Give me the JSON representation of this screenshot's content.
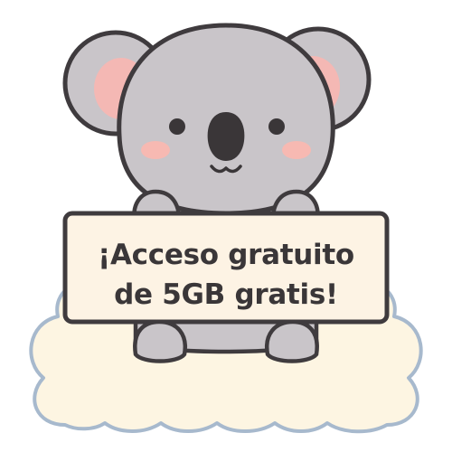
{
  "sticker": {
    "subject": "koala",
    "sign": {
      "line1": "¡Acceso gratuito",
      "line2": "de 5GB gratis!"
    }
  },
  "colors": {
    "fur": "#c9c5c9",
    "fur_light": "#d8d4d8",
    "outline": "#3f3b3e",
    "ear_inner": "#f4b8b4",
    "cheek": "#f7b9b2",
    "sign_fill": "#fdf3e4",
    "cloud_fill": "#fdf5e2",
    "cloud_outline": "#a7b9cd"
  }
}
